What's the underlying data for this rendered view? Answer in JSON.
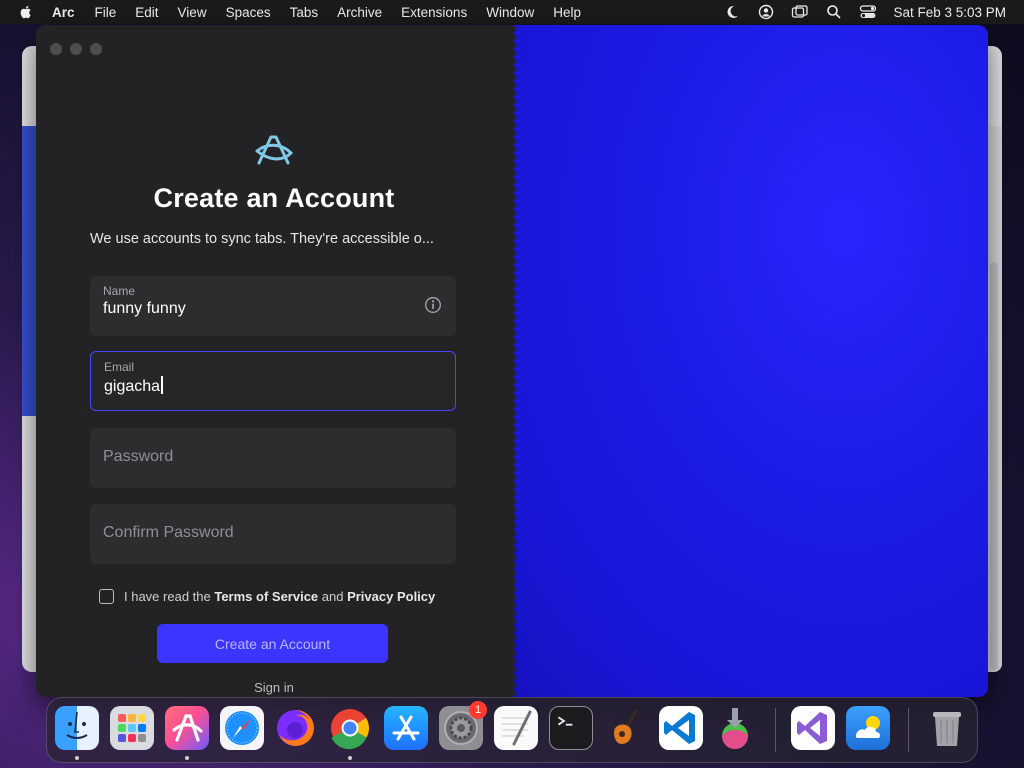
{
  "menubar": {
    "app_name": "Arc",
    "items": [
      "File",
      "Edit",
      "View",
      "Spaces",
      "Tabs",
      "Archive",
      "Extensions",
      "Window",
      "Help"
    ],
    "clock": "Sat Feb 3  5:03 PM"
  },
  "form": {
    "title": "Create an Account",
    "subtitle": "We use accounts to sync tabs. They're accessible o...",
    "name_label": "Name",
    "name_value": "funny funny",
    "email_label": "Email",
    "email_value": "gigacha",
    "password_placeholder": "Password",
    "confirm_placeholder": "Confirm Password",
    "terms_prefix": "I have read the ",
    "terms_link": "Terms of Service",
    "terms_and": " and ",
    "privacy_link": "Privacy Policy",
    "terms_checked": false,
    "create_button": "Create an Account",
    "signin_link": "Sign in"
  },
  "dock": {
    "settings_badge": "1",
    "apps": [
      "finder",
      "launchpad",
      "arc",
      "safari",
      "firefox",
      "chrome",
      "app-store",
      "system-settings",
      "textedit",
      "terminal",
      "garageband",
      "vscode",
      "disk-utility",
      "visual-studio",
      "weather",
      "trash"
    ]
  },
  "colors": {
    "accent": "#3b35ff",
    "background_right": "#1d1ce6",
    "window_bg": "#232325"
  }
}
